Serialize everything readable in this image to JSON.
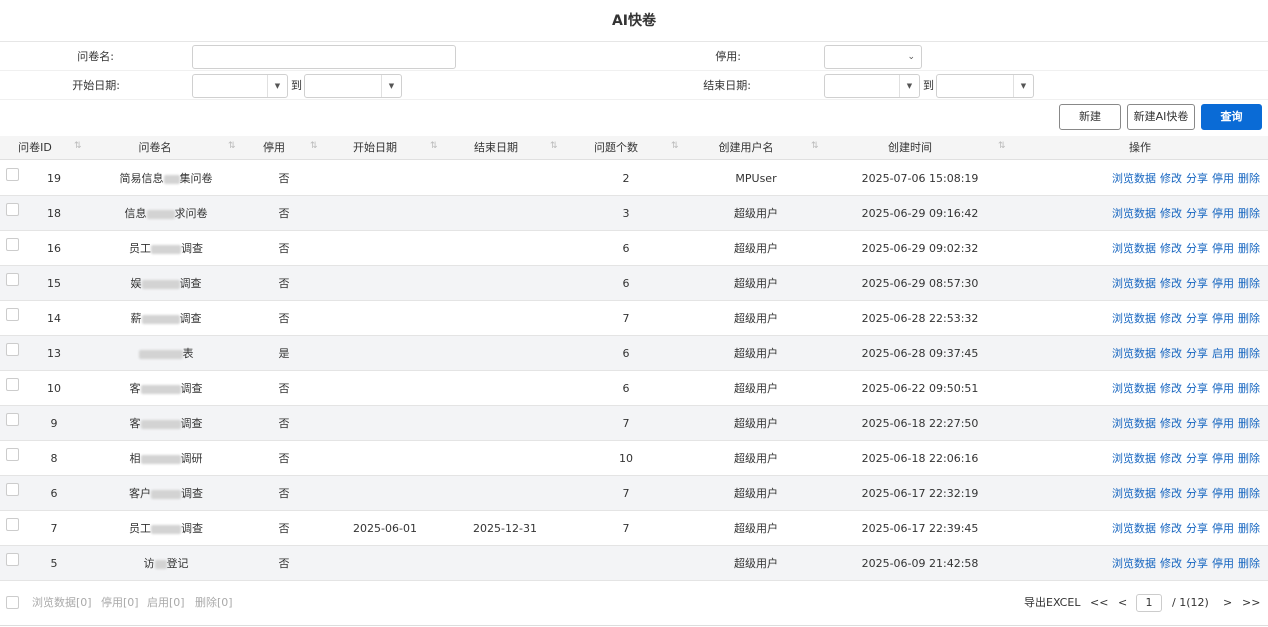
{
  "title": "AI快卷",
  "filters": {
    "name_label": "问卷名:",
    "name_value": "",
    "disabled_label": "停用:",
    "disabled_value": "",
    "start_label": "开始日期:",
    "start_from": "",
    "start_to": "",
    "end_label": "结束日期:",
    "end_from": "",
    "end_to": "",
    "to": "到"
  },
  "buttons": {
    "new": "新建",
    "new_ai": "新建AI快卷",
    "query": "查询"
  },
  "columns": [
    "问卷ID",
    "问卷名",
    "停用",
    "开始日期",
    "结束日期",
    "问题个数",
    "创建用户名",
    "创建时间",
    "操作"
  ],
  "rows": [
    {
      "id": "19",
      "name_a": "简易信息",
      "name_b": "集问卷",
      "disabled": "否",
      "start": "",
      "end": "",
      "count": "2",
      "user": "MPUser",
      "created": "2025-07-06 15:08:19",
      "toggle": "停用"
    },
    {
      "id": "18",
      "name_a": "信息",
      "name_b": "求问卷",
      "disabled": "否",
      "start": "",
      "end": "",
      "count": "3",
      "user": "超级用户",
      "created": "2025-06-29 09:16:42",
      "toggle": "停用"
    },
    {
      "id": "16",
      "name_a": "员工",
      "name_b": "调查",
      "disabled": "否",
      "start": "",
      "end": "",
      "count": "6",
      "user": "超级用户",
      "created": "2025-06-29 09:02:32",
      "toggle": "停用"
    },
    {
      "id": "15",
      "name_a": "娱",
      "name_b": "调查",
      "disabled": "否",
      "start": "",
      "end": "",
      "count": "6",
      "user": "超级用户",
      "created": "2025-06-29 08:57:30",
      "toggle": "停用"
    },
    {
      "id": "14",
      "name_a": "薪",
      "name_b": "调查",
      "disabled": "否",
      "start": "",
      "end": "",
      "count": "7",
      "user": "超级用户",
      "created": "2025-06-28 22:53:32",
      "toggle": "停用"
    },
    {
      "id": "13",
      "name_a": "",
      "name_b": "表",
      "disabled": "是",
      "start": "",
      "end": "",
      "count": "6",
      "user": "超级用户",
      "created": "2025-06-28 09:37:45",
      "toggle": "启用"
    },
    {
      "id": "10",
      "name_a": "客",
      "name_b": "调查",
      "disabled": "否",
      "start": "",
      "end": "",
      "count": "6",
      "user": "超级用户",
      "created": "2025-06-22 09:50:51",
      "toggle": "停用"
    },
    {
      "id": "9",
      "name_a": "客",
      "name_b": "调查",
      "disabled": "否",
      "start": "",
      "end": "",
      "count": "7",
      "user": "超级用户",
      "created": "2025-06-18 22:27:50",
      "toggle": "停用"
    },
    {
      "id": "8",
      "name_a": "相",
      "name_b": "调研",
      "disabled": "否",
      "start": "",
      "end": "",
      "count": "10",
      "user": "超级用户",
      "created": "2025-06-18 22:06:16",
      "toggle": "停用"
    },
    {
      "id": "6",
      "name_a": "客户",
      "name_b": "调查",
      "disabled": "否",
      "start": "",
      "end": "",
      "count": "7",
      "user": "超级用户",
      "created": "2025-06-17 22:32:19",
      "toggle": "停用"
    },
    {
      "id": "7",
      "name_a": "员工",
      "name_b": "调查",
      "disabled": "否",
      "start": "2025-06-01",
      "end": "2025-12-31",
      "count": "7",
      "user": "超级用户",
      "created": "2025-06-17 22:39:45",
      "toggle": "停用"
    },
    {
      "id": "5",
      "name_a": "访",
      "name_b": "登记",
      "disabled": "否",
      "start": "",
      "end": "",
      "count": "",
      "user": "超级用户",
      "created": "2025-06-09 21:42:58",
      "toggle": "停用"
    }
  ],
  "ops": {
    "browse": "浏览数据",
    "edit": "修改",
    "share": "分享",
    "delete": "删除"
  },
  "footer": {
    "bulk_browse": "浏览数据[0]",
    "bulk_disable": "停用[0]",
    "bulk_enable": "启用[0]",
    "bulk_delete": "删除[0]",
    "export": "导出EXCEL",
    "first": "<<",
    "prev": "<",
    "page": "1",
    "total": "/ 1(12)",
    "next": ">",
    "last": ">>"
  }
}
